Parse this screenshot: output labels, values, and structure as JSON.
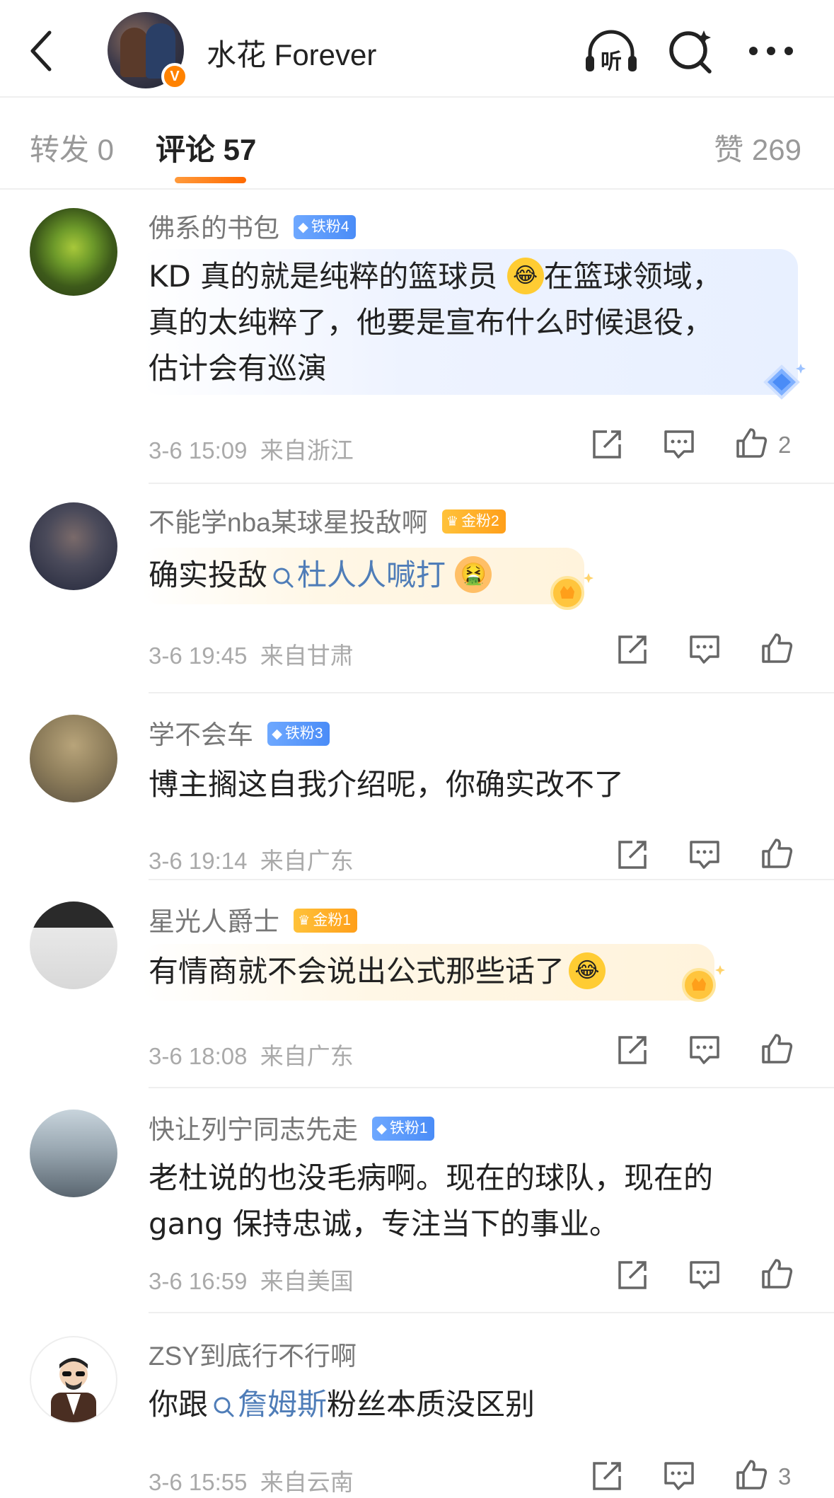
{
  "header": {
    "title": "水花 Forever",
    "verified_badge": "V",
    "icons": [
      "back-icon",
      "listen-icon",
      "search-icon",
      "more-icon"
    ],
    "listen_label": "听"
  },
  "tabs": {
    "repost": "转发 0",
    "comments": "评论 57",
    "likes": "赞 269"
  },
  "colors": {
    "accent": "#ff8200",
    "link": "#4f7db8",
    "iron_fan": "#4a8cf7",
    "gold_fan": "#ffa41a"
  },
  "comments": [
    {
      "name": "佛系的书包",
      "badge": "铁粉4",
      "badge_type": "iron",
      "line1_a": "KD 真的就是纯粹的篮球员",
      "line1_emoji": "😂",
      "line1_b": "在篮球领域，",
      "line2": "真的太纯粹了，他要是宣布什么时候退役，",
      "line3": "估计会有巡演",
      "time": "3-6 15:09",
      "location": "来自浙江",
      "likes": "2"
    },
    {
      "name": "不能学nba某球星投敌啊",
      "badge": "金粉2",
      "badge_type": "gold",
      "text_a": "确实投敌",
      "topic": "杜人人喊打",
      "emoji": "🤮",
      "time": "3-6 19:45",
      "location": "来自甘肃",
      "likes": ""
    },
    {
      "name": "学不会车",
      "badge": "铁粉3",
      "badge_type": "iron",
      "text": "博主搁这自我介绍呢，你确实改不了",
      "time": "3-6 19:14",
      "location": "来自广东",
      "likes": ""
    },
    {
      "name": "星光人爵士",
      "badge": "金粉1",
      "badge_type": "gold",
      "text": "有情商就不会说出公式那些话了",
      "emoji": "😂",
      "time": "3-6 18:08",
      "location": "来自广东",
      "likes": ""
    },
    {
      "name": "快让列宁同志先走",
      "badge": "铁粉1",
      "badge_type": "iron",
      "line1": "老杜说的也没毛病啊。现在的球队，现在的",
      "line2": "gang 保持忠诚，专注当下的事业。",
      "time": "3-6 16:59",
      "location": "来自美国",
      "likes": ""
    },
    {
      "name": "ZSY到底行不行啊",
      "text_a": "你跟",
      "topic": "詹姆斯",
      "text_b": "粉丝本质没区别",
      "time": "3-6 15:55",
      "location": "来自云南",
      "likes": "3"
    }
  ]
}
